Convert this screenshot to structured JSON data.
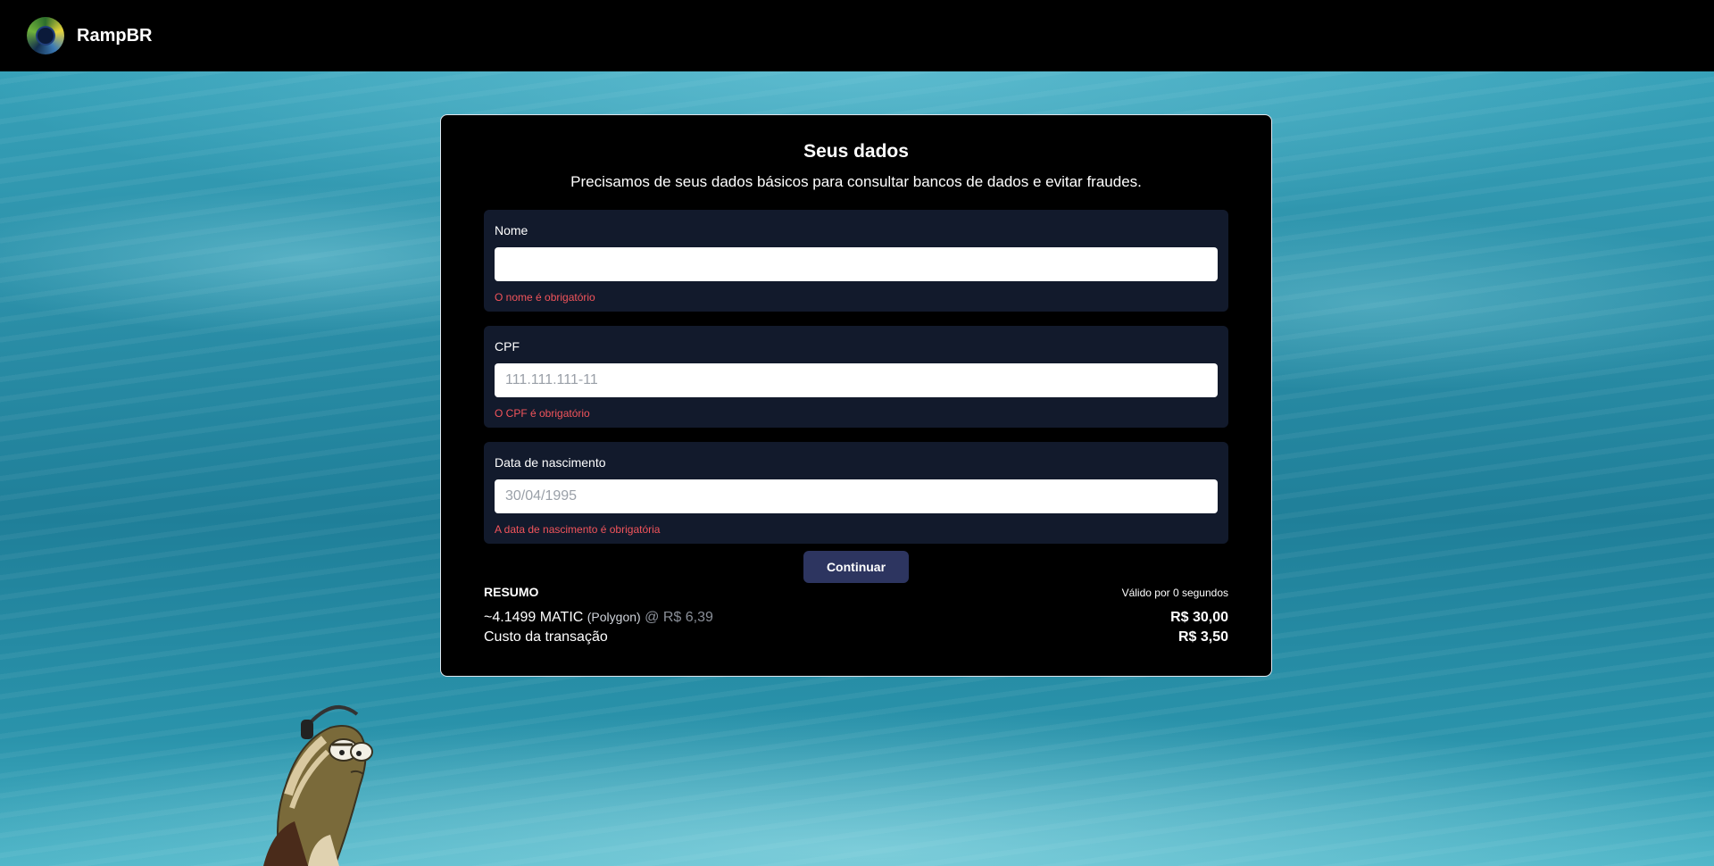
{
  "header": {
    "brand": "RampBR"
  },
  "form": {
    "title": "Seus dados",
    "subtitle": "Precisamos de seus dados básicos para consultar bancos de dados e evitar fraudes.",
    "fields": [
      {
        "label": "Nome",
        "value": "",
        "placeholder": "",
        "error": "O nome é obrigatório"
      },
      {
        "label": "CPF",
        "value": "",
        "placeholder": "111.111.111-11",
        "error": "O CPF é obrigatório"
      },
      {
        "label": "Data de nascimento",
        "value": "",
        "placeholder": "30/04/1995",
        "error": "A data de nascimento é obrigatória"
      }
    ],
    "continue_label": "Continuar"
  },
  "summary": {
    "heading": "RESUMO",
    "validity": "Válido por 0 segundos",
    "crypto_amount": "~4.1499 MATIC",
    "network": "(Polygon)",
    "rate": "@ R$ 6,39",
    "crypto_total": "R$ 30,00",
    "fee_label": "Custo da transação",
    "fee_value": "R$ 3,50"
  },
  "colors": {
    "error": "#f2545b",
    "button": "#2d3560",
    "field_bg": "#121a2c"
  }
}
